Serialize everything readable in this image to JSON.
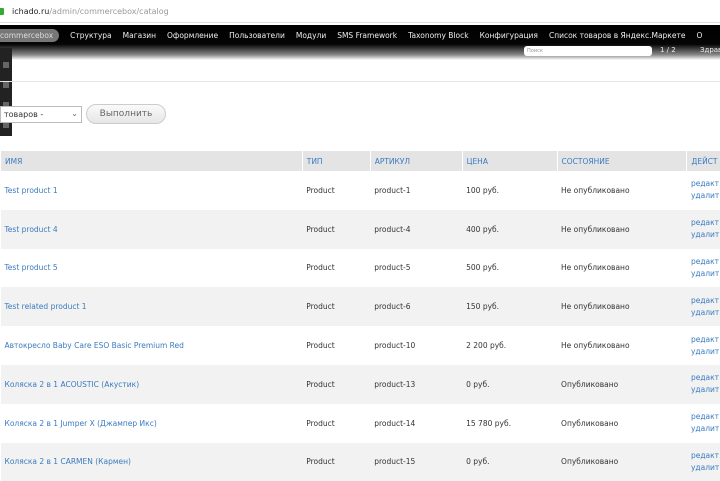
{
  "browser": {
    "url_host": "ichado.ru",
    "url_path": "/admin/commercebox/catalog"
  },
  "toolbar": {
    "menu": [
      "commercebox",
      "Структура",
      "Магазин",
      "Оформление",
      "Пользователи",
      "Модули",
      "SMS Framework",
      "Taxonomy Block",
      "Конфигурация",
      "Список товаров в Яндекс.Маркете",
      "О"
    ],
    "search_placeholder": "Поиск",
    "pager": "1 / 2",
    "hello": "Здрав"
  },
  "bulk": {
    "select_value": "товаров -",
    "execute_label": "Выполнить"
  },
  "table": {
    "headers": [
      "ИМЯ",
      "ТИП",
      "АРТИКУЛ",
      "ЦЕНА",
      "СОСТОЯНИЕ",
      "ДЕЙСТ"
    ],
    "action_edit": "редакт",
    "action_delete": "удалит",
    "rows": [
      [
        "Test product 1",
        "Product",
        "product-1",
        "100 руб.",
        "Не опубликовано"
      ],
      [
        "Test product 4",
        "Product",
        "product-4",
        "400 руб.",
        "Не опубликовано"
      ],
      [
        "Test product 5",
        "Product",
        "product-5",
        "500 руб.",
        "Не опубликовано"
      ],
      [
        "Test related product 1",
        "Product",
        "product-6",
        "150 руб.",
        "Не опубликовано"
      ],
      [
        "Автокресло Baby Care ESO Basic Premium Red",
        "Product",
        "product-10",
        "2 200 руб.",
        "Не опубликовано"
      ],
      [
        "Коляска 2 в 1 ACOUSTIC (Акустик)",
        "Product",
        "product-13",
        "0 руб.",
        "Опубликовано"
      ],
      [
        "Коляска 2 в 1 Jumper X (Джампер Икс)",
        "Product",
        "product-14",
        "15 780 руб.",
        "Опубликовано"
      ],
      [
        "Коляска 2 в 1 CARMEN (Кармен)",
        "Product",
        "product-15",
        "0 руб.",
        "Опубликовано"
      ]
    ]
  }
}
